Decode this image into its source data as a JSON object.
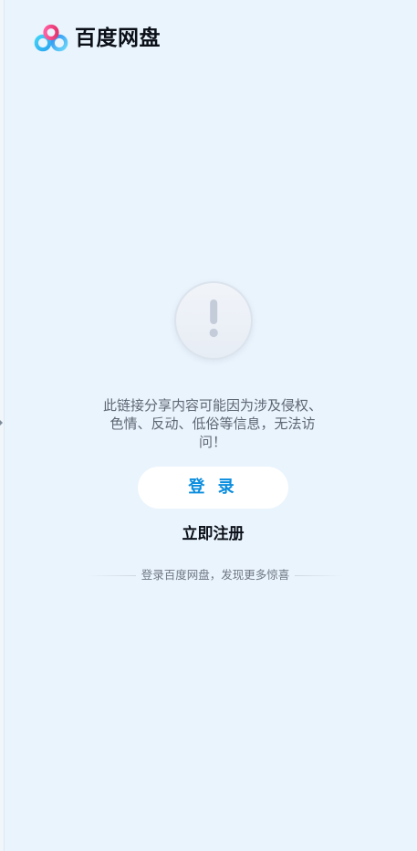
{
  "header": {
    "logo_icon": "baidu-netdisk-logo-icon",
    "brand_name": "百度网盘"
  },
  "notice": {
    "icon": "exclamation-icon",
    "message": "此链接分享内容可能因为涉及侵权、色情、反动、低俗等信息，无法访问！"
  },
  "actions": {
    "login_label": "登 录",
    "register_label": "立即注册"
  },
  "footer": {
    "tagline": "登录百度网盘，发现更多惊喜"
  },
  "colors": {
    "background": "#eaf4fd",
    "accent": "#0a8dde",
    "text_dark": "#0b0f17",
    "text_muted": "#5d6673"
  }
}
